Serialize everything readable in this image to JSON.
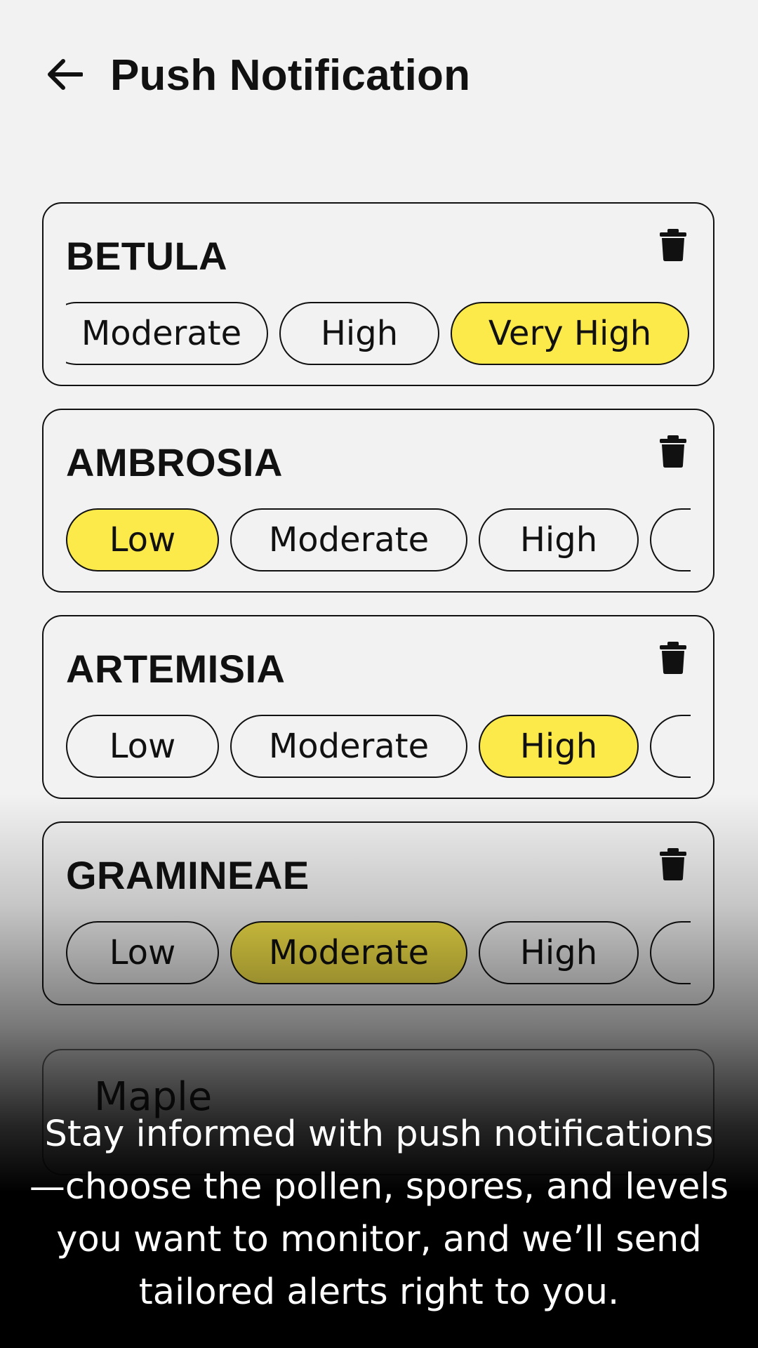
{
  "header": {
    "title": "Push Notification",
    "back_icon": "arrow-left-icon"
  },
  "cards": [
    {
      "name": "BETULA",
      "chips": [
        "Moderate",
        "High",
        "Very High"
      ],
      "selected": "Very High"
    },
    {
      "name": "AMBROSIA",
      "chips": [
        "Low",
        "Moderate",
        "High"
      ],
      "selected": "Low"
    },
    {
      "name": "ARTEMISIA",
      "chips": [
        "Low",
        "Moderate",
        "High"
      ],
      "selected": "High"
    },
    {
      "name": "GRAMINEAE",
      "chips": [
        "Low",
        "Moderate",
        "High"
      ],
      "selected": "Moderate"
    },
    {
      "name": "Maple"
    }
  ],
  "caption": "Stay informed with push notifications —choose the pollen, spores, and levels you want to monitor, and we’ll send tailored alerts right to you.",
  "colors": {
    "accent": "#fcea4b",
    "background": "#f2f2f2",
    "text": "#111111"
  },
  "icons": {
    "delete": "trash-icon"
  }
}
